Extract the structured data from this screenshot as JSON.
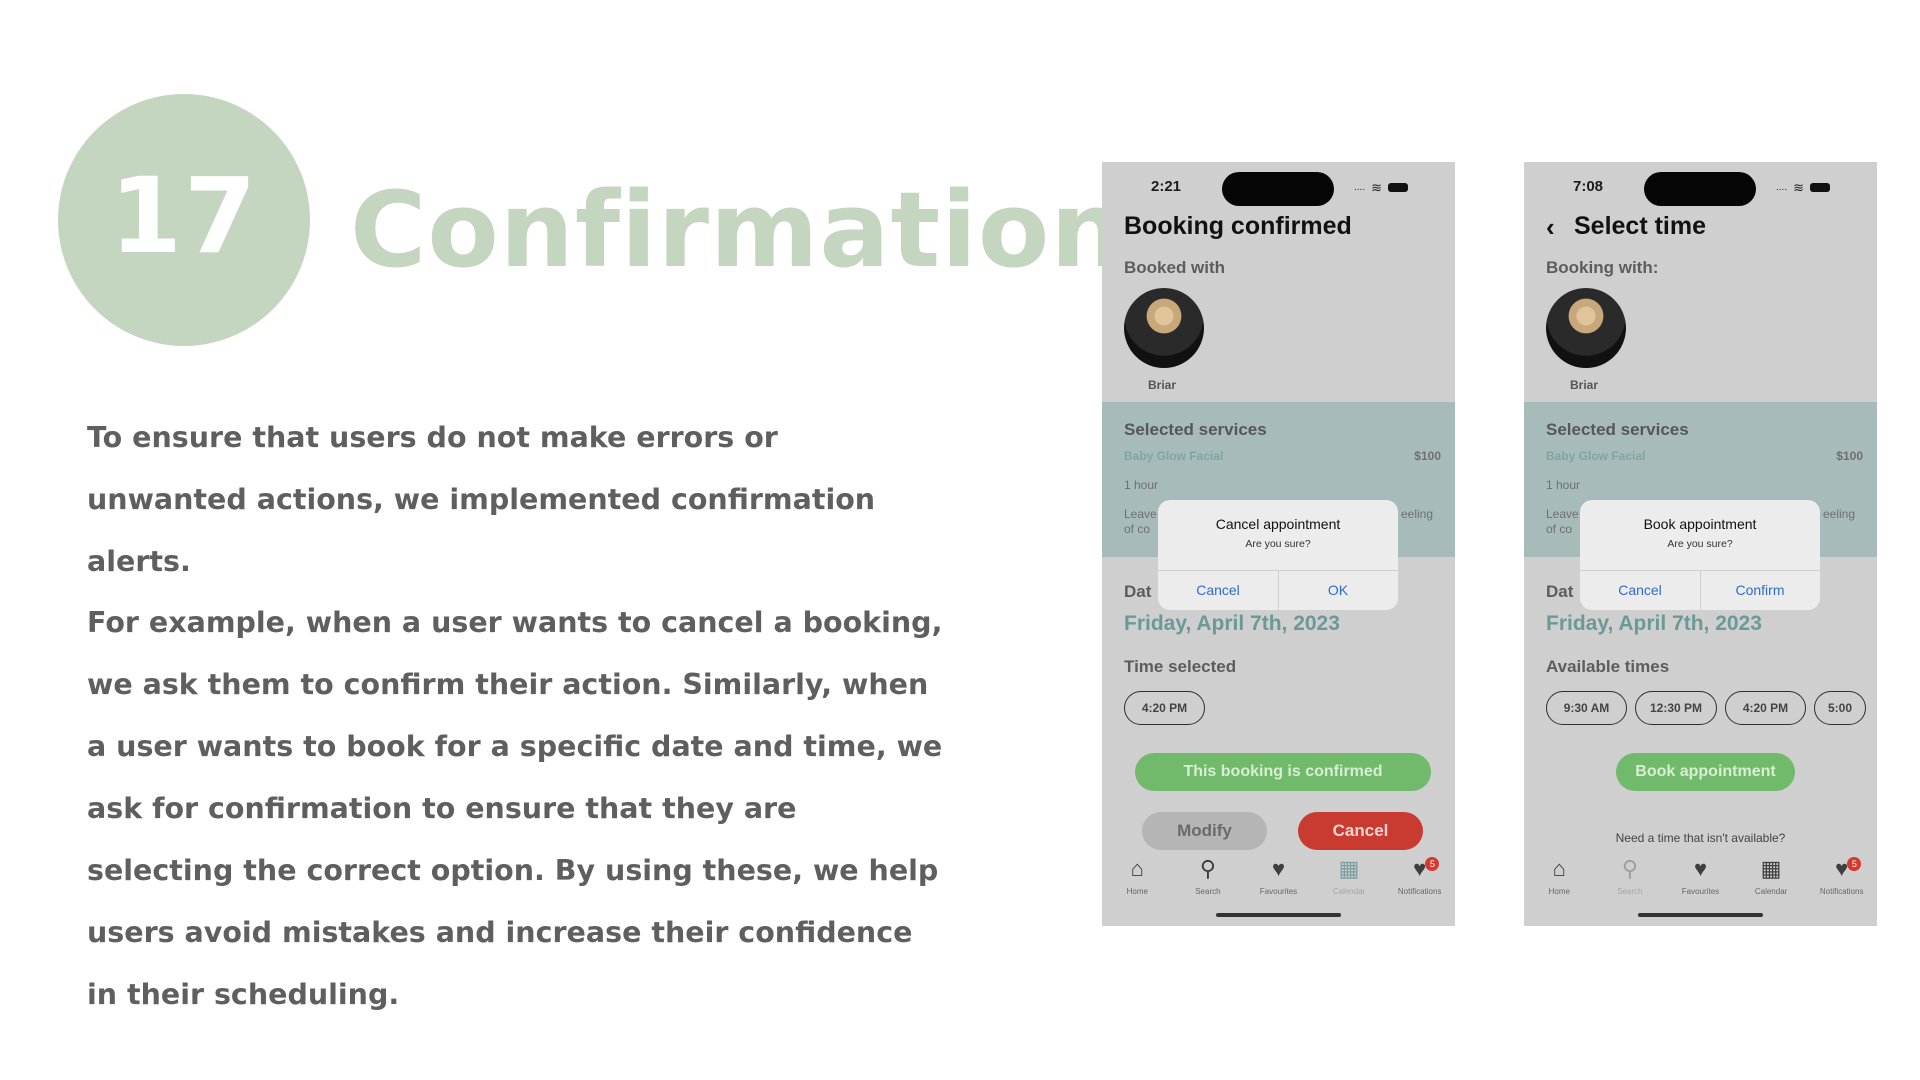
{
  "slide": {
    "number": "17",
    "title": "Confirmation",
    "paragraph1": "To ensure that users do not make errors or unwanted actions, we implemented confirmation alerts.",
    "paragraph2": "For example, when a user wants to cancel a booking, we ask them to confirm their action. Similarly, when a user wants to book for a specific date and time, we ask for confirmation to ensure that they are selecting the correct option. By using these, we help users avoid mistakes and increase their confidence in their scheduling."
  },
  "colors": {
    "accent_green": "#c5d6c0",
    "services_band": "#a7bcba",
    "confirm_green": "#72ba6b",
    "cancel_red": "#c93b30",
    "alert_link_blue": "#2e6cd1"
  },
  "phone_a": {
    "status_time": "2:21",
    "status_dots": "....",
    "title": "Booking confirmed",
    "booked_with_label": "Booked with",
    "provider_name": "Briar",
    "services_title": "Selected services",
    "service_name": "Baby Glow Facial",
    "service_price": "$100",
    "service_duration": "1 hour",
    "service_note_left_1": "Leave",
    "service_note_left_2": "of co",
    "service_note_right": "eeling",
    "date_label": "Dat",
    "date_value": "Friday, April 7th, 2023",
    "time_label": "Time selected",
    "time_chip": "4:20 PM",
    "confirmed_banner": "This booking is confirmed",
    "modify_label": "Modify",
    "cancel_label": "Cancel",
    "alert": {
      "title": "Cancel appointment",
      "message": "Are you sure?",
      "left_button": "Cancel",
      "right_button": "OK"
    }
  },
  "phone_b": {
    "status_time": "7:08",
    "status_dots": "....",
    "back_icon": "‹",
    "title": "Select time",
    "booked_with_label": "Booking with:",
    "provider_name": "Briar",
    "services_title": "Selected services",
    "service_name": "Baby Glow Facial",
    "service_price": "$100",
    "service_duration": "1 hour",
    "service_note_left_1": "Leave",
    "service_note_left_2": "of co",
    "service_note_right": "eeling",
    "date_label": "Dat",
    "date_value": "Friday, April 7th, 2023",
    "times_label": "Available times",
    "times": [
      "9:30 AM",
      "12:30 PM",
      "4:20 PM",
      "5:00"
    ],
    "book_button": "Book appointment",
    "need_time_link": "Need a time that isn't available?",
    "alert": {
      "title": "Book appointment",
      "message": "Are you sure?",
      "left_button": "Cancel",
      "right_button": "Confirm"
    }
  },
  "tabbar": {
    "home": "Home",
    "search": "Search",
    "favourites": "Favourites",
    "calendar": "Calendar",
    "notifications": "Notifications",
    "badge_count": "5"
  }
}
